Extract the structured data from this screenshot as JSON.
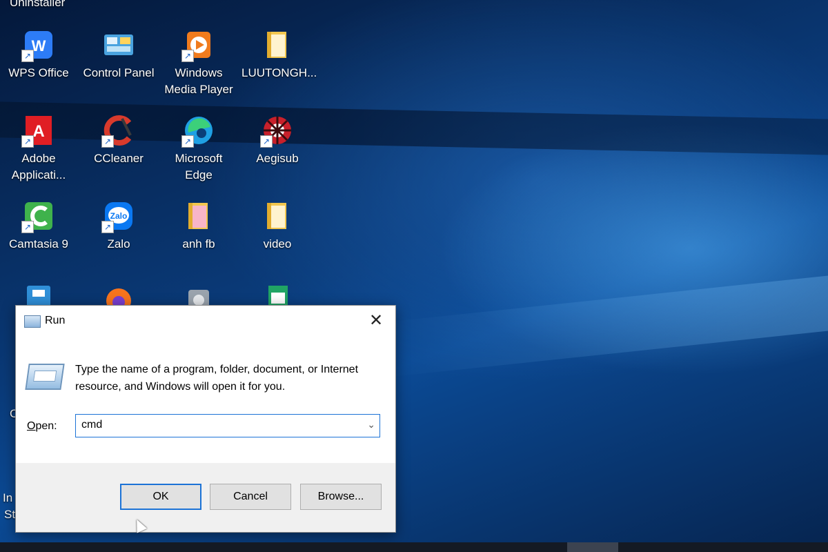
{
  "desktop": {
    "cut_top_label": "Uninstaller",
    "icons": [
      {
        "label": "WPS Office",
        "icon": "wps-office-icon",
        "color": "#2d7cf6"
      },
      {
        "label": "Control Panel",
        "icon": "control-panel-icon",
        "color": "#4aa3df"
      },
      {
        "label": "Windows Media Player",
        "icon": "media-player-icon",
        "color": "#f07b1d"
      },
      {
        "label": "LUUTONGH...",
        "icon": "folder-icon",
        "color": "#f3c74f"
      },
      {
        "label": "Adobe Applicati...",
        "icon": "adobe-icon",
        "color": "#e01e24"
      },
      {
        "label": "CCleaner",
        "icon": "ccleaner-icon",
        "color": "#d83a2c"
      },
      {
        "label": "Microsoft Edge",
        "icon": "edge-icon",
        "color": "#1fa0e3"
      },
      {
        "label": "Aegisub",
        "icon": "aegisub-icon",
        "color": "#c8202b"
      },
      {
        "label": "Camtasia 9",
        "icon": "camtasia-icon",
        "color": "#3fb24c"
      },
      {
        "label": "Zalo",
        "icon": "zalo-icon",
        "color": "#0a78f2"
      },
      {
        "label": "anh fb",
        "icon": "folder-icon",
        "color": "#f3c74f"
      },
      {
        "label": "video",
        "icon": "folder-icon",
        "color": "#f3c74f"
      }
    ],
    "partial_left_labels": [
      "C",
      "In",
      "St"
    ]
  },
  "run_dialog": {
    "title": "Run",
    "description": "Type the name of a program, folder, document, or Internet resource, and Windows will open it for you.",
    "open_label_first": "O",
    "open_label_rest": "pen:",
    "open_value": "cmd",
    "ok_label": "OK",
    "cancel_label": "Cancel",
    "browse_label": "Browse...",
    "close_glyph": "✕"
  }
}
